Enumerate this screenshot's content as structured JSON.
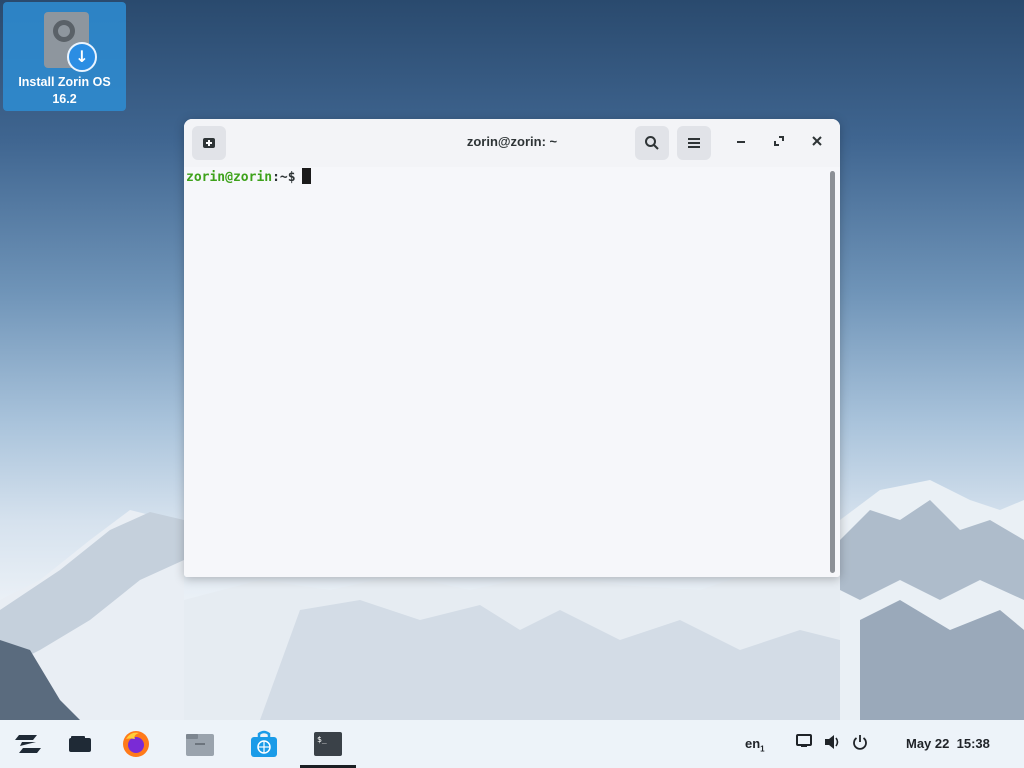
{
  "desktop": {
    "icon_label_line1": "Install Zorin OS",
    "icon_label_line2": "16.2"
  },
  "terminal": {
    "title": "zorin@zorin: ~",
    "prompt_user": "zorin@zorin",
    "prompt_path": ":~$",
    "buttons": {
      "new_tab": "new-tab-icon",
      "search": "search-icon",
      "menu": "hamburger-menu-icon",
      "minimize": "minimize-icon",
      "maximize": "maximize-icon",
      "close": "close-icon"
    }
  },
  "taskbar": {
    "apps": [
      "zorin-menu",
      "show-desktop",
      "firefox",
      "files",
      "software-store",
      "terminal"
    ],
    "language": "en",
    "language_sub": "1",
    "date": "May 22",
    "time": "15:38"
  },
  "colors": {
    "prompt_green": "#3ea21b",
    "accent_blue": "#2e8dd4"
  }
}
